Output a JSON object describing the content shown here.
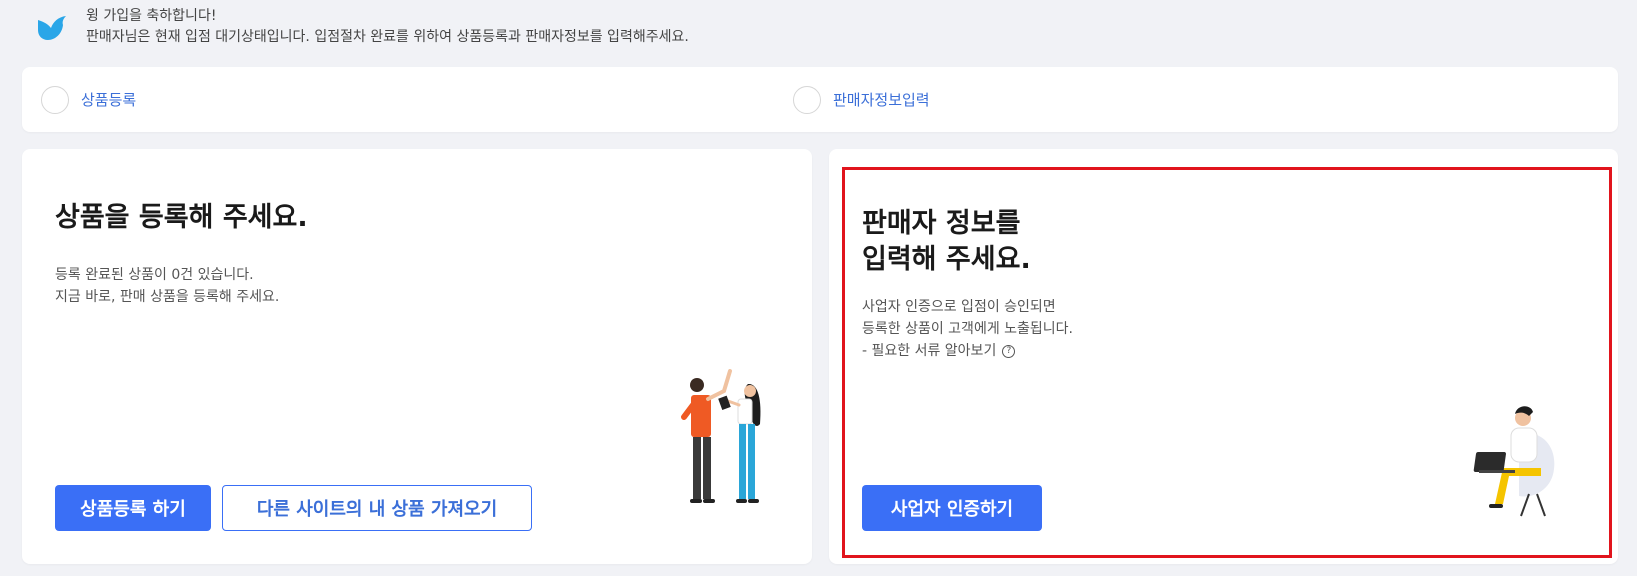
{
  "notice": {
    "icon": "bird-icon",
    "line1": "윙 가입을 축하합니다!",
    "line2": "판매자님은 현재 입점 대기상태입니다. 입점절차 완료를 위하여 상품등록과 판매자정보를 입력해주세요."
  },
  "steps": [
    {
      "label": "상품등록"
    },
    {
      "label": "판매자정보입력"
    }
  ],
  "product_card": {
    "title": "상품을 등록해 주세요.",
    "desc_line1": "등록 완료된 상품이 0건 있습니다.",
    "desc_line2": "지금 바로, 판매 상품을 등록해 주세요.",
    "primary_button": "상품등록 하기",
    "secondary_button": "다른 사이트의 내 상품 가져오기"
  },
  "seller_card": {
    "title_line1": "판매자 정보를",
    "title_line2": "입력해 주세요.",
    "desc_line1": "사업자 인증으로 입점이 승인되면",
    "desc_line2": "등록한 상품이 고객에게 노출됩니다.",
    "desc_line3": "- 필요한 서류 알아보기",
    "help_icon": "?",
    "button": "사업자 인증하기"
  },
  "colors": {
    "accent": "#3a6ff6",
    "link": "#3b6fd8",
    "highlight": "#e1141d",
    "bird": "#2aa6e8"
  }
}
